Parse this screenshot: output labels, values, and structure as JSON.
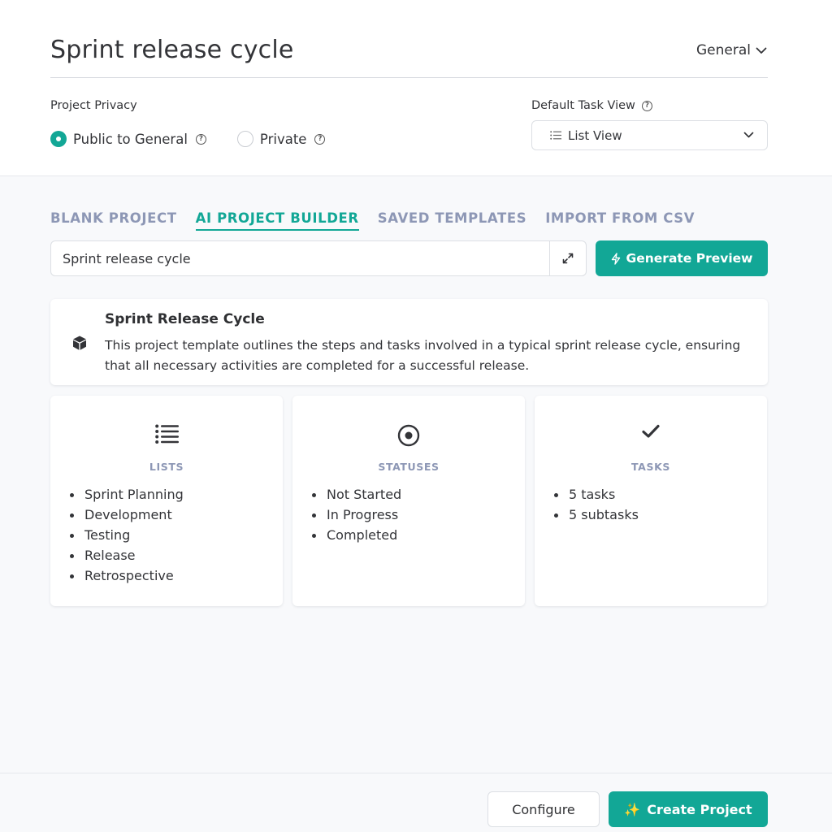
{
  "header": {
    "title": "Sprint release cycle",
    "space_selector": "General"
  },
  "privacy": {
    "label": "Project Privacy",
    "options": [
      {
        "label": "Public to General",
        "selected": true
      },
      {
        "label": "Private",
        "selected": false
      }
    ]
  },
  "task_view": {
    "label": "Default Task View",
    "selected": "List View"
  },
  "tabs": [
    {
      "label": "BLANK PROJECT",
      "active": false
    },
    {
      "label": "AI PROJECT BUILDER",
      "active": true
    },
    {
      "label": "SAVED TEMPLATES",
      "active": false
    },
    {
      "label": "IMPORT FROM CSV",
      "active": false
    }
  ],
  "prompt": {
    "value": "Sprint release cycle",
    "generate_label": "Generate Preview"
  },
  "summary": {
    "title": "Sprint Release Cycle",
    "description": "This project template outlines the steps and tasks involved in a typical sprint release cycle, ensuring that all necessary activities are completed for a successful release."
  },
  "cards": [
    {
      "title": "LISTS",
      "icon": "list-icon",
      "items": [
        "Sprint Planning",
        "Development",
        "Testing",
        "Release",
        "Retrospective"
      ]
    },
    {
      "title": "STATUSES",
      "icon": "target-icon",
      "items": [
        "Not Started",
        "In Progress",
        "Completed"
      ]
    },
    {
      "title": "TASKS",
      "icon": "check-icon",
      "items": [
        "5 tasks",
        "5 subtasks"
      ]
    }
  ],
  "footer": {
    "configure_label": "Configure",
    "create_label": "Create Project",
    "create_emoji": "✨"
  },
  "colors": {
    "accent": "#12a796",
    "tab_inactive": "#8d97b5",
    "text": "#333438"
  }
}
